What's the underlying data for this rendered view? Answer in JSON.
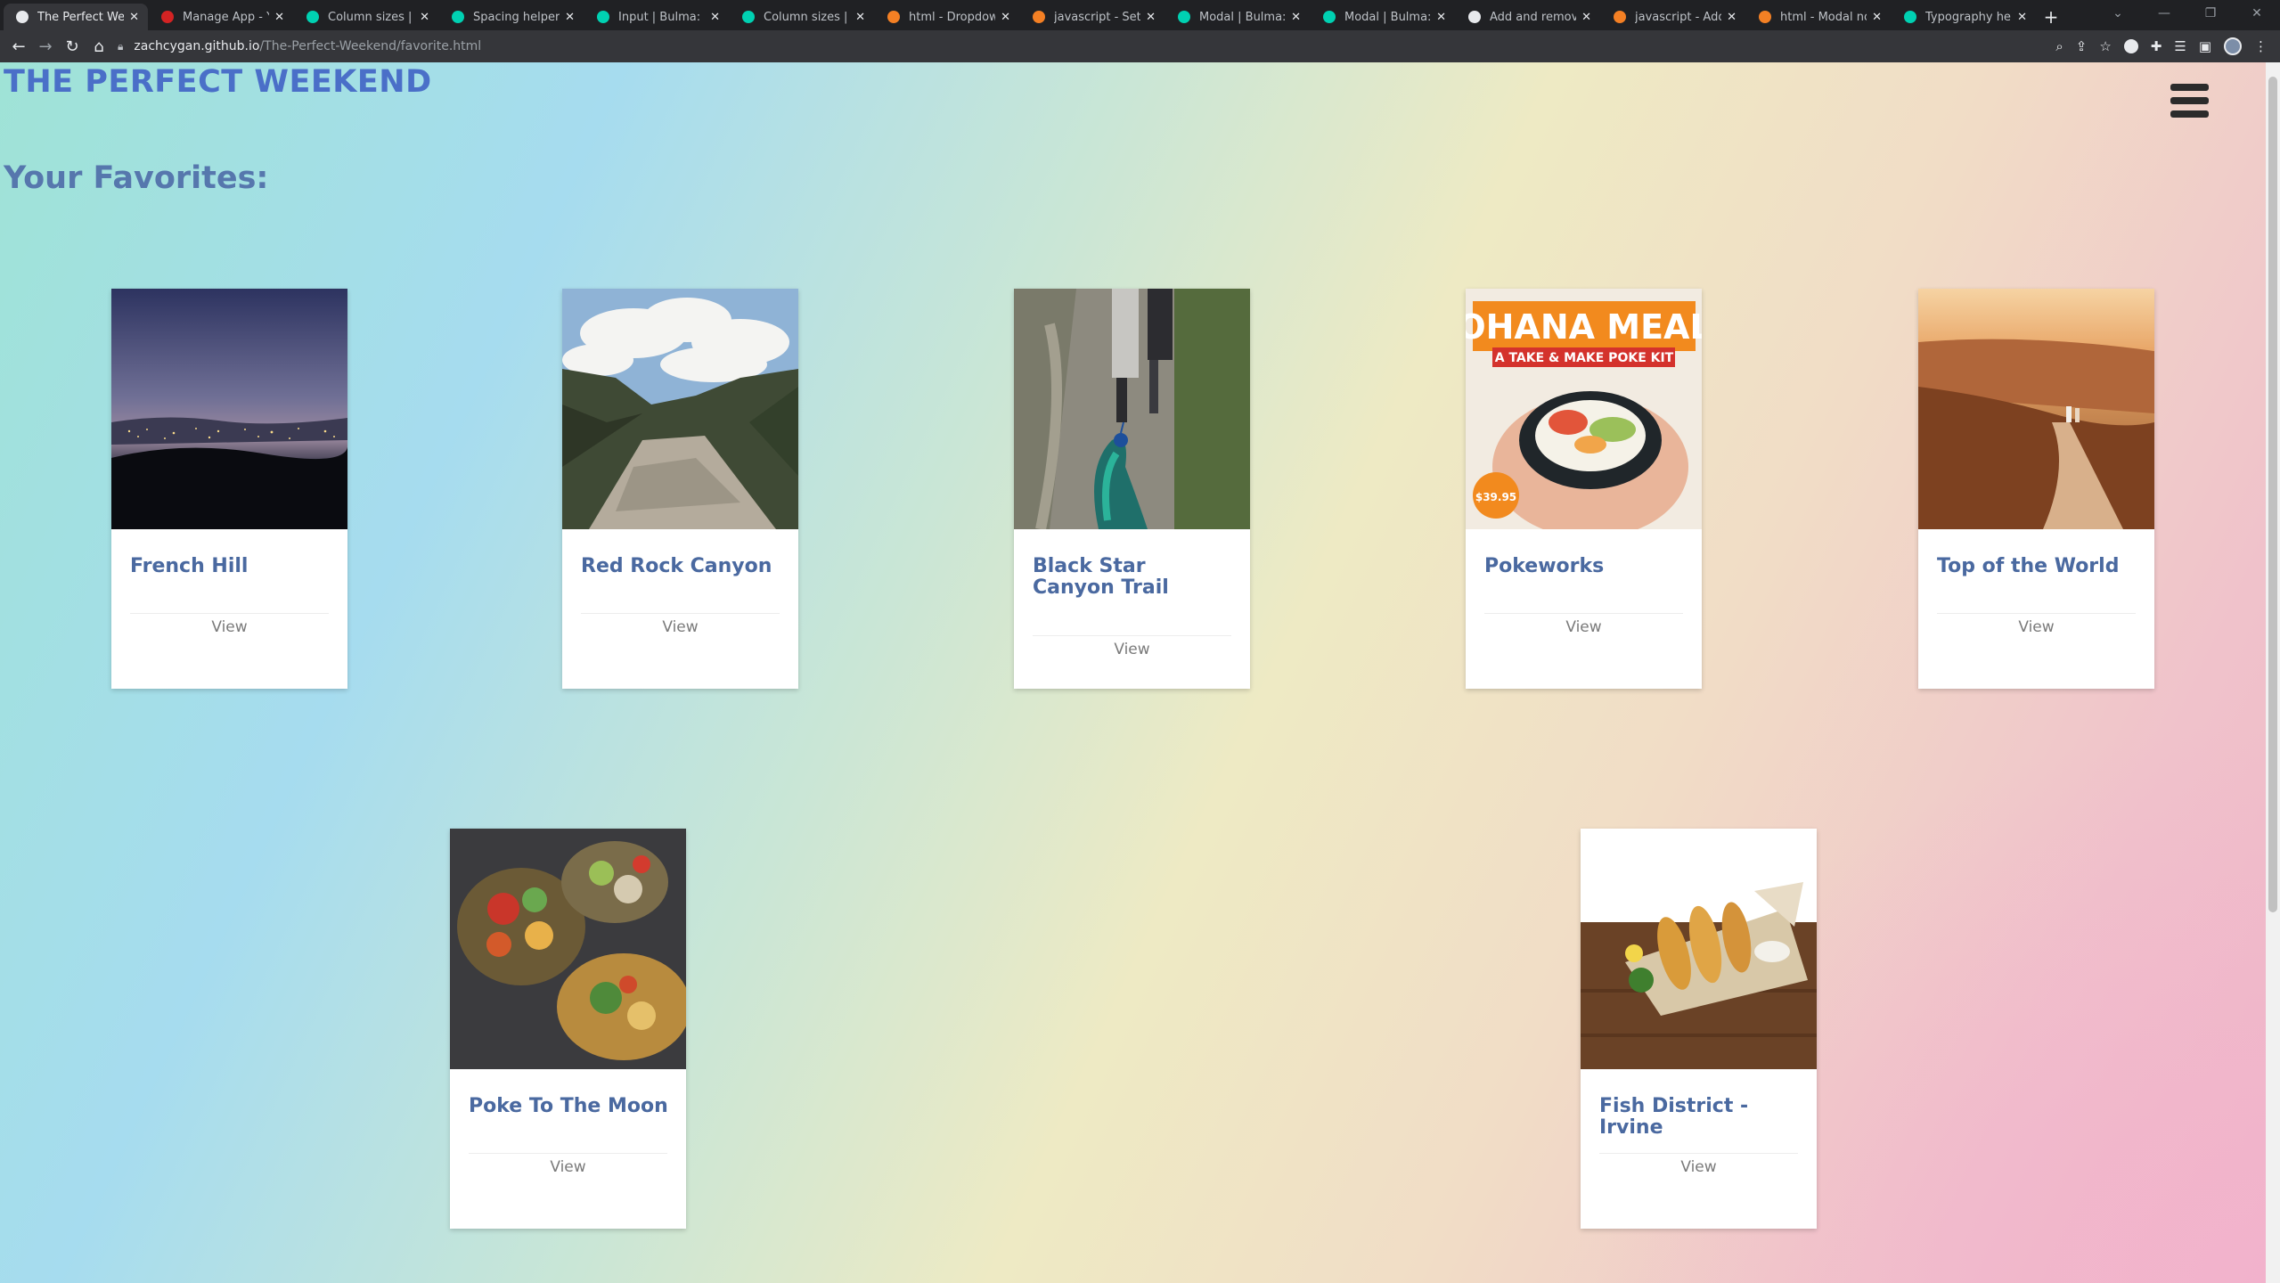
{
  "browser": {
    "tabs": [
      {
        "title": "The Perfect Weeke",
        "active": true,
        "icon": "globe-icon",
        "icon_color": "#e8eaed"
      },
      {
        "title": "Manage App - Yel",
        "icon": "yelp-icon",
        "icon_color": "#d32323"
      },
      {
        "title": "Column sizes | Bu",
        "icon": "bulma-icon",
        "icon_color": "#00d1b2"
      },
      {
        "title": "Spacing helpers | B",
        "icon": "bulma-icon",
        "icon_color": "#00d1b2"
      },
      {
        "title": "Input | Bulma: Fre",
        "icon": "bulma-icon",
        "icon_color": "#00d1b2"
      },
      {
        "title": "Column sizes | Bu",
        "icon": "bulma-icon",
        "icon_color": "#00d1b2"
      },
      {
        "title": "html - Dropdown",
        "icon": "stackoverflow-icon",
        "icon_color": "#f48024"
      },
      {
        "title": "javascript - Set th",
        "icon": "stackoverflow-icon",
        "icon_color": "#f48024"
      },
      {
        "title": "Modal | Bulma: Fr",
        "icon": "bulma-icon",
        "icon_color": "#00d1b2"
      },
      {
        "title": "Modal | Bulma: Fr",
        "icon": "bulma-icon",
        "icon_color": "#00d1b2"
      },
      {
        "title": "Add and remove c",
        "icon": "w3-icon",
        "icon_color": "#e8eaed"
      },
      {
        "title": "javascript - Add D",
        "icon": "stackoverflow-icon",
        "icon_color": "#f48024"
      },
      {
        "title": "html - Modal not",
        "icon": "stackoverflow-icon",
        "icon_color": "#f48024"
      },
      {
        "title": "Typography helpe",
        "icon": "bulma-icon",
        "icon_color": "#00d1b2"
      }
    ],
    "url_host": "zachcygan.github.io",
    "url_path": "/The-Perfect-Weekend/favorite.html"
  },
  "page": {
    "site_title": "THE PERFECT WEEKEND",
    "favorites_heading": "Your Favorites:",
    "cards": [
      {
        "name": "French Hill",
        "action": "View",
        "image": "night-city-view"
      },
      {
        "name": "Red Rock Canyon",
        "action": "View",
        "image": "canyon-clouds"
      },
      {
        "name": "Black Star Canyon Trail",
        "action": "View",
        "image": "trail-peacock"
      },
      {
        "name": "Pokeworks",
        "action": "View",
        "image": "poke-kit-ad",
        "image_headline": "OHANA MEAL",
        "image_subline": "A TAKE & MAKE POKE KIT",
        "image_price": "$39.95"
      },
      {
        "name": "Top of the World",
        "action": "View",
        "image": "sunset-hill-path"
      },
      {
        "name": "Poke To The Moon",
        "action": "View",
        "image": "poke-bowls"
      },
      {
        "name": "Fish District - Irvine",
        "action": "View",
        "image": "fish-and-chips"
      }
    ]
  },
  "colors": {
    "title": "#4a6fc8",
    "heading": "#5677ad",
    "card_name": "#4a69a0"
  }
}
